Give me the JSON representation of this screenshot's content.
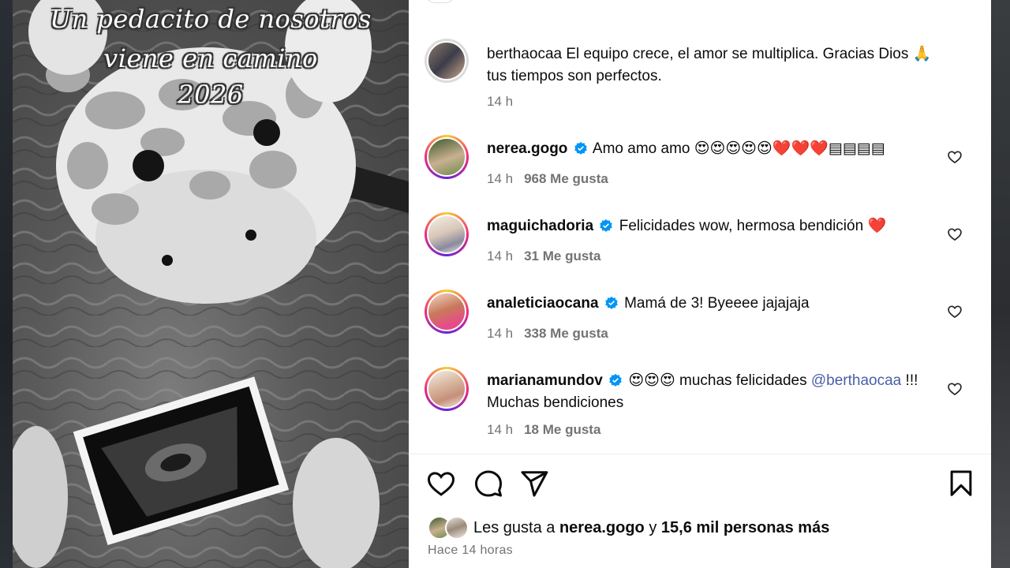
{
  "media": {
    "overlay_lines": [
      "Un pedacito de nosotros",
      "viene en camino",
      "2026"
    ]
  },
  "caption": {
    "user": "berthaocaa",
    "text": "El equipo crece, el amor se multiplica. Gracias Dios 🙏 tus tiempos son perfectos.",
    "time": "14 h"
  },
  "comments": [
    {
      "user": "nerea.gogo",
      "verified": true,
      "text": "Amo amo amo 😍😍😍😍😍❤️❤️❤️▤▤▤▤",
      "time": "14 h",
      "likes": "968 Me gusta"
    },
    {
      "user": "maguichadoria",
      "verified": true,
      "text": "Felicidades wow, hermosa bendición ❤️",
      "time": "14 h",
      "likes": "31 Me gusta"
    },
    {
      "user": "analeticiaocana",
      "verified": true,
      "text": "Mamá de 3! Byeeee jajajaja",
      "time": "14 h",
      "likes": "338 Me gusta"
    },
    {
      "user": "marianamundov",
      "verified": true,
      "text_before": "😍😍😍 muchas felicidades ",
      "mention": "@berthaocaa",
      "text_after": " !!! Muchas bendiciones",
      "time": "14 h",
      "likes": "18 Me gusta"
    }
  ],
  "actions": {
    "icons": [
      "heart-icon",
      "comment-icon",
      "share-icon",
      "bookmark-icon"
    ]
  },
  "likes_summary": {
    "prefix": "Les gusta a ",
    "user": "nerea.gogo",
    "middle": " y ",
    "count": "15,6 mil personas más"
  },
  "posted": "Hace 14 horas",
  "colors": {
    "verified_blue": "#0095f6",
    "meta_gray": "#737373",
    "story_ring": "#ee2a7b"
  }
}
